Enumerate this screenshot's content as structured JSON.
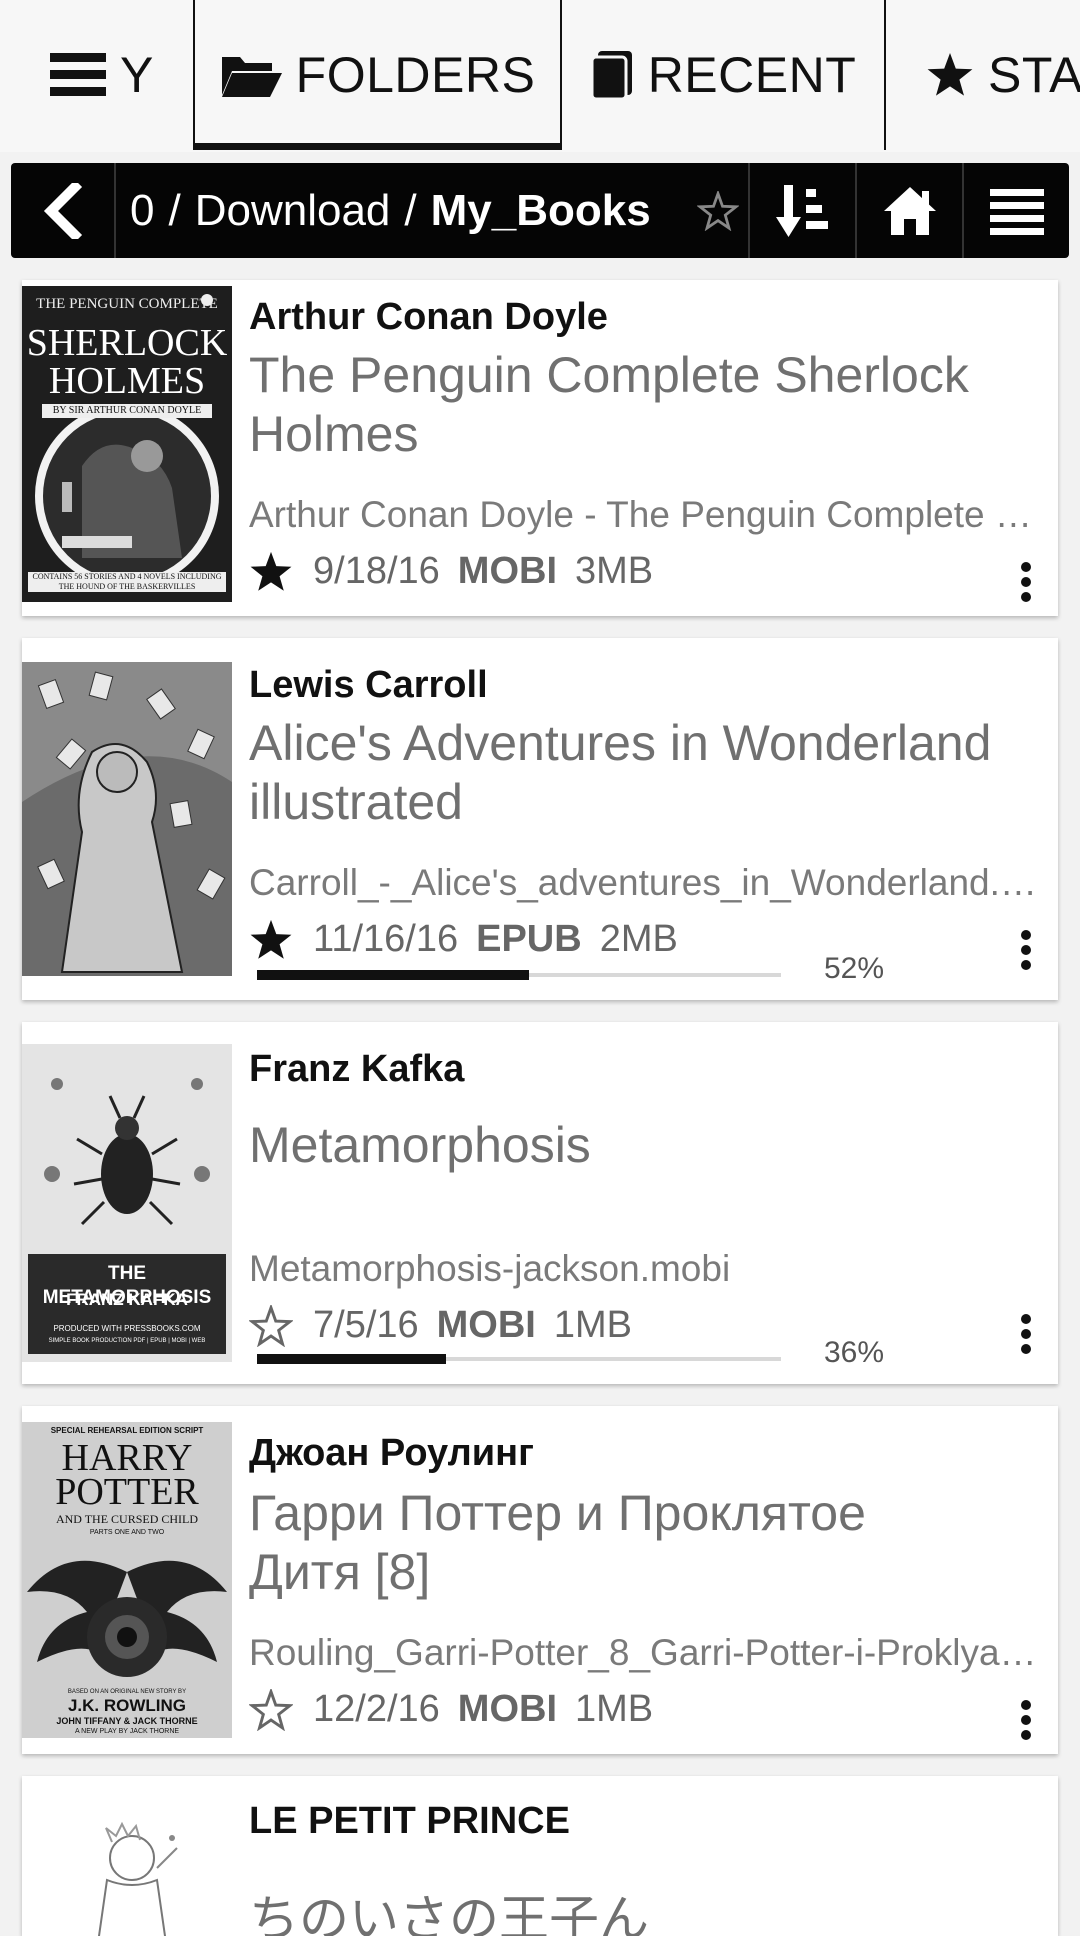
{
  "tabs": {
    "menu_partial": "Y",
    "folders": "FOLDERS",
    "recent": "RECENT",
    "starred_partial": "STA"
  },
  "path": {
    "root": "0",
    "separator": "/",
    "folder": "Download",
    "current": "My_Books"
  },
  "books": [
    {
      "author": "Arthur Conan Doyle",
      "title": "The Penguin Complete Sherlock Holmes",
      "filename": "Arthur Conan Doyle - The Penguin Complete S…",
      "starred": true,
      "date": "9/18/16",
      "format": "MOBI",
      "size": "3MB",
      "cover": {
        "top": "THE PENGUIN COMPLETE",
        "title1": "SHERLOCK",
        "title2": "HOLMES",
        "byline": "BY SIR ARTHUR CONAN DOYLE",
        "footer": "CONTAINS 56 STORIES AND 4 NOVELS INCLUDING THE HOUND OF THE BASKERVILLES"
      }
    },
    {
      "author": "Lewis Carroll",
      "title": "Alice's Adventures in Wonderland illustrated",
      "filename": "Carroll_-_Alice's_adventures_in_Wonderland.e…",
      "starred": true,
      "date": "11/16/16",
      "format": "EPUB",
      "size": "2MB",
      "progress": 0.52,
      "progress_label": "52%"
    },
    {
      "author": "Franz Kafka",
      "title": "Metamorphosis",
      "filename": "Metamorphosis-jackson.mobi",
      "starred": false,
      "date": "7/5/16",
      "format": "MOBI",
      "size": "1MB",
      "progress": 0.36,
      "progress_label": "36%",
      "cover": {
        "title1": "THE METAMORPHOSIS",
        "title2": "FRANZ KAFKA",
        "footer1": "PRODUCED WITH PRESSBOOKS.COM",
        "footer2": "SIMPLE BOOK PRODUCTION PDF | EPUB | MOBI | WEB"
      }
    },
    {
      "author": "Джоан Роулинг",
      "title": "Гарри Поттер и Проклятое Дитя [8]",
      "filename": "Rouling_Garri-Potter_8_Garri-Potter-i-Proklyat…",
      "starred": false,
      "date": "12/2/16",
      "format": "MOBI",
      "size": "1MB",
      "cover": {
        "top": "SPECIAL REHEARSAL EDITION SCRIPT",
        "title1": "HARRY",
        "title2": "POTTER",
        "sub": "AND THE CURSED CHILD",
        "parts": "PARTS ONE AND TWO",
        "based": "BASED ON AN ORIGINAL NEW STORY BY",
        "author": "J.K. ROWLING",
        "coauthors": "JOHN TIFFANY & JACK THORNE",
        "play": "A NEW PLAY BY JACK THORNE"
      }
    },
    {
      "author": "LE PETIT PRINCE",
      "title": "ちのいさの王子ん"
    }
  ]
}
